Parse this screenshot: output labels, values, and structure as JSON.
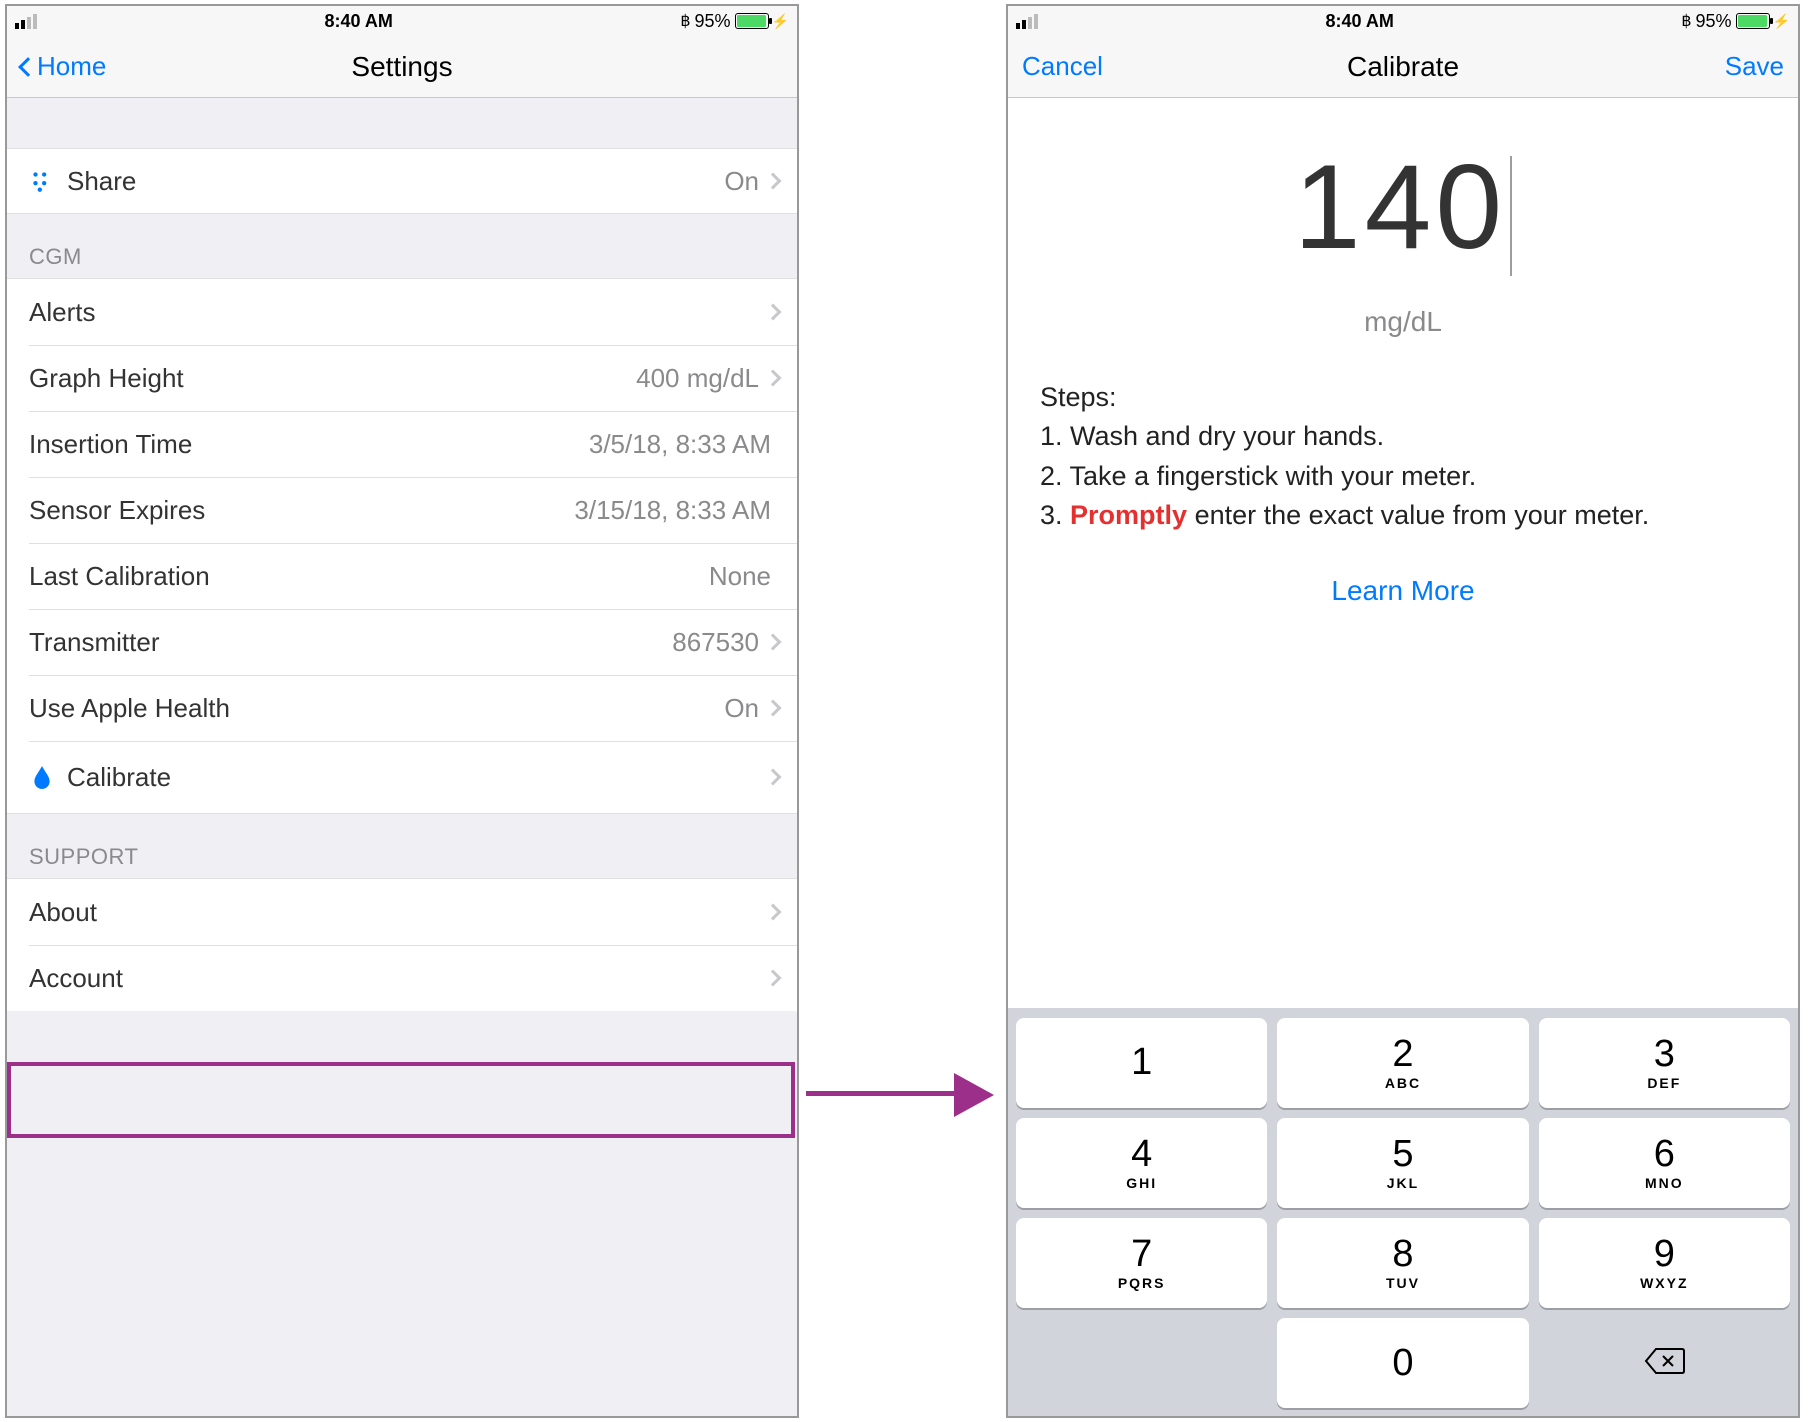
{
  "status": {
    "time": "8:40 AM",
    "battery_pct": "95%",
    "bluetooth_icon": "✱",
    "bolt_icon": "⚡︎"
  },
  "left": {
    "nav": {
      "back_label": "Home",
      "title": "Settings"
    },
    "share_row": {
      "label": "Share",
      "value": "On"
    },
    "sections": {
      "cgm_header": "CGM",
      "alerts": {
        "label": "Alerts"
      },
      "graph_height": {
        "label": "Graph Height",
        "value": "400 mg/dL"
      },
      "insertion_time": {
        "label": "Insertion Time",
        "value": "3/5/18, 8:33 AM"
      },
      "sensor_expires": {
        "label": "Sensor Expires",
        "value": "3/15/18, 8:33 AM"
      },
      "last_calibration": {
        "label": "Last Calibration",
        "value": "None"
      },
      "transmitter": {
        "label": "Transmitter",
        "value": "867530"
      },
      "apple_health": {
        "label": "Use Apple Health",
        "value": "On"
      },
      "calibrate": {
        "label": "Calibrate"
      },
      "support_header": "SUPPORT",
      "about": {
        "label": "About"
      },
      "account": {
        "label": "Account"
      }
    }
  },
  "right": {
    "nav": {
      "cancel_label": "Cancel",
      "title": "Calibrate",
      "save_label": "Save"
    },
    "value": "140",
    "unit": "mg/dL",
    "steps_title": "Steps:",
    "step1": "1. Wash and dry your hands.",
    "step2": "2. Take a fingerstick with your meter.",
    "step3_prefix": "3. ",
    "step3_emph": "Promptly",
    "step3_suffix": " enter the exact value from your meter.",
    "learn_more": "Learn More",
    "keypad": {
      "k1": {
        "d": "1",
        "l": ""
      },
      "k2": {
        "d": "2",
        "l": "ABC"
      },
      "k3": {
        "d": "3",
        "l": "DEF"
      },
      "k4": {
        "d": "4",
        "l": "GHI"
      },
      "k5": {
        "d": "5",
        "l": "JKL"
      },
      "k6": {
        "d": "6",
        "l": "MNO"
      },
      "k7": {
        "d": "7",
        "l": "PQRS"
      },
      "k8": {
        "d": "8",
        "l": "TUV"
      },
      "k9": {
        "d": "9",
        "l": "WXYZ"
      },
      "k0": {
        "d": "0",
        "l": ""
      }
    }
  }
}
